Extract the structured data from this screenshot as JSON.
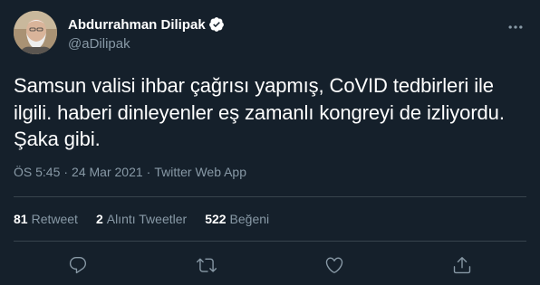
{
  "user": {
    "display_name": "Abdurrahman Dilipak",
    "handle": "@aDilipak",
    "verified": true
  },
  "tweet": {
    "text": "Samsun valisi ihbar çağrısı yapmış, CoVID tedbirleri ile ilgili. haberi dinleyenler eş zamanlı kongreyi de izliyordu. Şaka gibi.",
    "time": "ÖS 5:45",
    "separator": "·",
    "date": "24 Mar 2021",
    "source": "Twitter Web App"
  },
  "stats": {
    "retweets": {
      "count": "81",
      "label": "Retweet"
    },
    "quotes": {
      "count": "2",
      "label": "Alıntı Tweetler"
    },
    "likes": {
      "count": "522",
      "label": "Beğeni"
    }
  },
  "icons": {
    "verified": "verified-badge-icon",
    "more": "more-options-icon",
    "reply": "reply-icon",
    "retweet": "retweet-icon",
    "like": "heart-icon",
    "share": "share-icon"
  },
  "colors": {
    "background": "#15202b",
    "text_primary": "#ffffff",
    "text_secondary": "#8899a6",
    "divider": "#38444d",
    "accent": "#ffffff"
  }
}
